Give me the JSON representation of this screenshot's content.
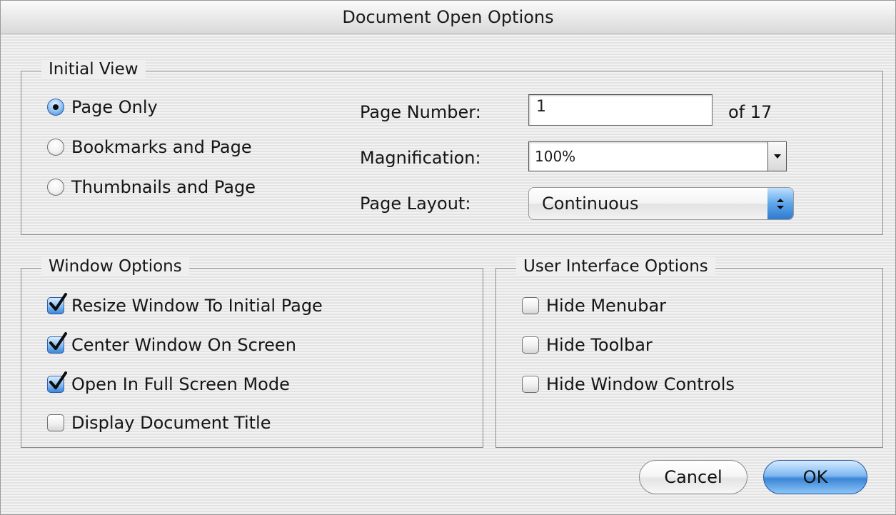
{
  "dialog": {
    "title": "Document Open Options"
  },
  "initial_view": {
    "title": "Initial View",
    "radios": [
      {
        "label": "Page Only",
        "checked": true
      },
      {
        "label": "Bookmarks and Page",
        "checked": false
      },
      {
        "label": "Thumbnails and Page",
        "checked": false
      }
    ],
    "page_number": {
      "label": "Page Number:",
      "value": "1",
      "of_text": "of 17"
    },
    "magnification": {
      "label": "Magnification:",
      "value": "100%"
    },
    "page_layout": {
      "label": "Page Layout:",
      "value": "Continuous"
    }
  },
  "window_options": {
    "title": "Window Options",
    "items": [
      {
        "label": "Resize Window To Initial Page",
        "checked": true
      },
      {
        "label": "Center Window On Screen",
        "checked": true
      },
      {
        "label": "Open In Full Screen Mode",
        "checked": true
      },
      {
        "label": "Display Document Title",
        "checked": false
      }
    ]
  },
  "ui_options": {
    "title": "User Interface Options",
    "items": [
      {
        "label": "Hide Menubar",
        "checked": false
      },
      {
        "label": "Hide Toolbar",
        "checked": false
      },
      {
        "label": "Hide Window Controls",
        "checked": false
      }
    ]
  },
  "buttons": {
    "cancel_label": "Cancel",
    "ok_label": "OK"
  },
  "colors": {
    "accent": "#3b85d6",
    "panel_bg": "#efefef"
  }
}
